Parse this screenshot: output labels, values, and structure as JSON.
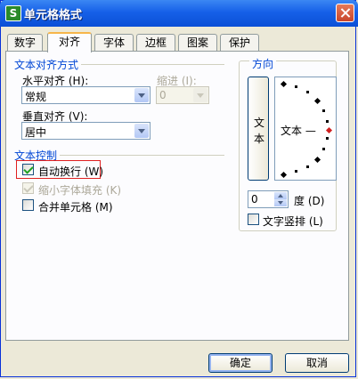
{
  "window": {
    "title": "单元格格式",
    "app_icon_letter": "S"
  },
  "tabs": [
    {
      "label": "数字",
      "active": false
    },
    {
      "label": "对齐",
      "active": true
    },
    {
      "label": "字体",
      "active": false
    },
    {
      "label": "边框",
      "active": false
    },
    {
      "label": "图案",
      "active": false
    },
    {
      "label": "保护",
      "active": false
    }
  ],
  "text_alignment": {
    "group_title": "文本对齐方式",
    "horizontal_label": "水平对齐 (H):",
    "horizontal_value": "常规",
    "indent_label": "缩进 (I):",
    "indent_value": "0",
    "vertical_label": "垂直对齐 (V):",
    "vertical_value": "居中"
  },
  "text_control": {
    "group_title": "文本控制",
    "wrap_text_label": "自动换行 (W)",
    "wrap_text_checked": true,
    "shrink_to_fit_label": "缩小字体填充 (K)",
    "shrink_to_fit_checked": true,
    "merge_cells_label": "合并单元格 (M)",
    "merge_cells_checked": false
  },
  "orientation": {
    "group_title": "方向",
    "vertical_text_chars": [
      "文",
      "本"
    ],
    "dial_text": "文本 —",
    "degrees_value": "0",
    "degrees_label": "度 (D)",
    "vertical_text_label": "文字竖排 (L)",
    "vertical_text_checked": false
  },
  "buttons": {
    "ok": "确定",
    "cancel": "取消"
  },
  "colors": {
    "title_bar": "#0a4fd6",
    "group_title": "#0046d5",
    "highlight": "#e02020",
    "active_tab_accent": "#f7b64a"
  }
}
